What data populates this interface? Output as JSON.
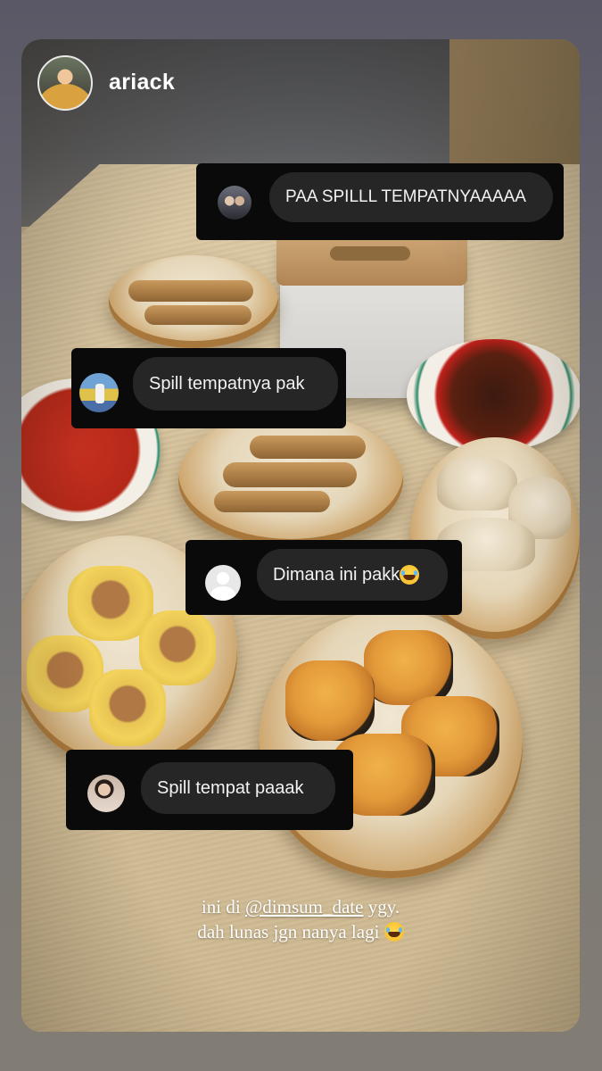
{
  "story": {
    "username": "ariack",
    "avatar_icon": "profile-photo-avatar"
  },
  "replies": [
    {
      "text": "PAA SPILLL TEMPATNYAAAAA",
      "avatar_icon": "couple-photo-avatar"
    },
    {
      "text": "Spill tempatnya pak",
      "avatar_icon": "figure-blue-sky-avatar"
    },
    {
      "text": "Dimana ini pakk",
      "avatar_icon": "default-user-avatar",
      "emoji": "laughing-tears-emoji"
    },
    {
      "text": "Spill tempat paaak",
      "avatar_icon": "woman-photo-avatar"
    }
  ],
  "caption": {
    "line1_prefix": "ini di ",
    "mention": "@dimsum_date",
    "line1_suffix": " ygy.",
    "line2": "dah lunas jgn nanya lagi",
    "emoji": "laughing-tears-emoji"
  },
  "colors": {
    "sticker_bg": "#0a0a0a",
    "pill_bg": "#262626",
    "text": "#ffffff"
  }
}
